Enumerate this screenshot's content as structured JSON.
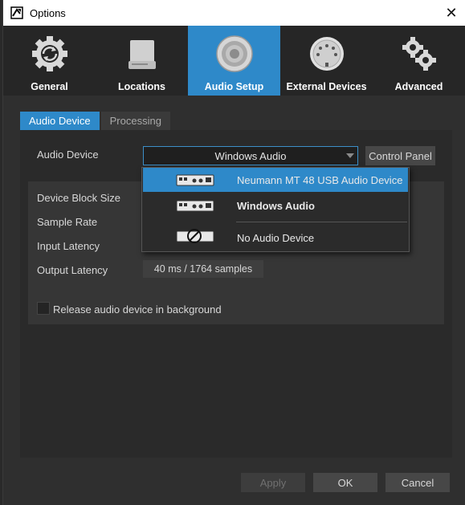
{
  "window": {
    "title": "Options"
  },
  "toolbar": {
    "items": [
      {
        "label": "General",
        "icon": "gear-refresh-icon"
      },
      {
        "label": "Locations",
        "icon": "drive-icon"
      },
      {
        "label": "Audio Setup",
        "icon": "speaker-icon"
      },
      {
        "label": "External Devices",
        "icon": "midi-port-icon"
      },
      {
        "label": "Advanced",
        "icon": "gears-icon"
      }
    ],
    "active_index": 2
  },
  "tabs": [
    {
      "label": "Audio Device",
      "active": true
    },
    {
      "label": "Processing",
      "active": false
    }
  ],
  "audio_device": {
    "label": "Audio Device",
    "selected": "Windows Audio",
    "control_panel_label": "Control Panel",
    "options": [
      {
        "label": "Neumann MT 48 USB Audio Device",
        "highlighted": true,
        "bold": false
      },
      {
        "label": "Windows Audio",
        "highlighted": false,
        "bold": true
      },
      {
        "label": "No Audio Device",
        "highlighted": false,
        "bold": false
      }
    ]
  },
  "settings": {
    "device_block_size_label": "Device Block Size",
    "sample_rate_label": "Sample Rate",
    "input_latency_label": "Input Latency",
    "output_latency_label": "Output Latency",
    "output_latency_value": "40 ms / 1764 samples",
    "release_label": "Release audio device in background",
    "release_checked": false
  },
  "footer": {
    "apply_label": "Apply",
    "ok_label": "OK",
    "cancel_label": "Cancel"
  },
  "colors": {
    "accent": "#2e89c9",
    "background": "#2f2f2f",
    "toolbar": "#262626"
  }
}
